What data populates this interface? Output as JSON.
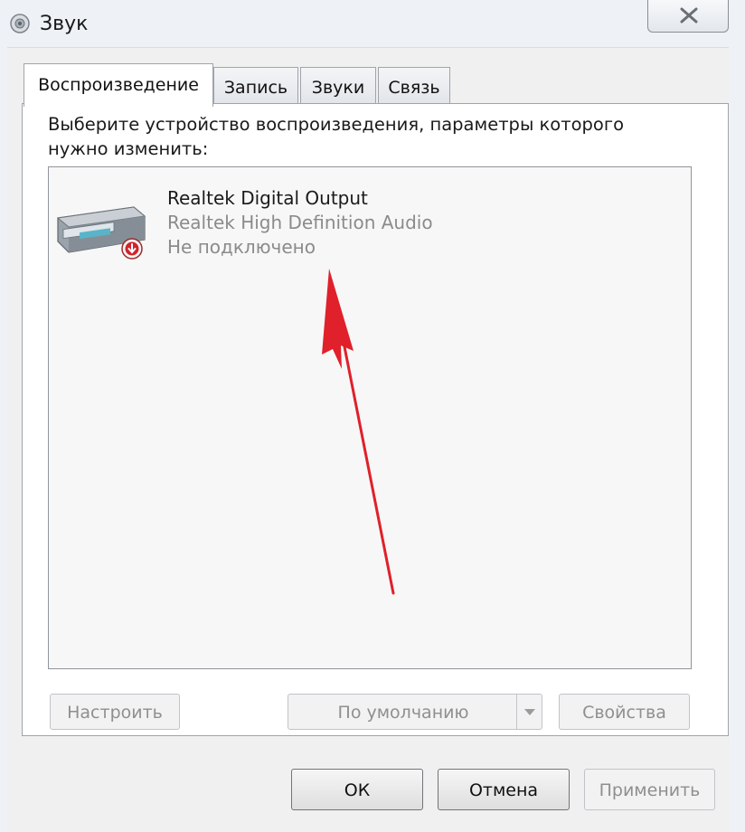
{
  "window": {
    "title": "Звук"
  },
  "tabs": [
    {
      "label": "Воспроизведение",
      "active": true
    },
    {
      "label": "Запись",
      "active": false
    },
    {
      "label": "Звуки",
      "active": false
    },
    {
      "label": "Связь",
      "active": false
    }
  ],
  "playback": {
    "instruction": "Выберите устройство воспроизведения, параметры которого нужно изменить:",
    "devices": [
      {
        "name": "Realtek Digital Output",
        "driver": "Realtek High Definition Audio",
        "status": "Не подключено",
        "icon": "speaker-device-icon",
        "status_icon": "down-arrow-badge-icon"
      }
    ],
    "configure_label": "Настроить",
    "default_label": "По умолчанию",
    "properties_label": "Свойства"
  },
  "footer": {
    "ok_label": "ОК",
    "cancel_label": "Отмена",
    "apply_label": "Применить"
  },
  "annotation": {
    "arrow_color": "#e0202a"
  },
  "colors": {
    "window_bg": "#f0f0f0",
    "list_bg": "#f7f7f7",
    "disabled_text": "#8f8f8f",
    "secondary_text": "#8b8b8b"
  }
}
